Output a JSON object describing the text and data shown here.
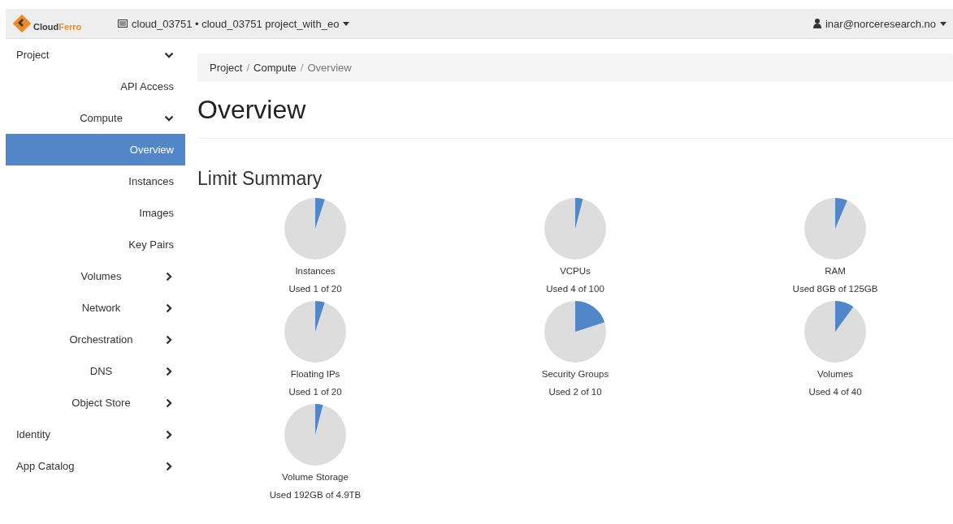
{
  "header": {
    "brand": "Cloud",
    "brand_accent": "Ferro",
    "project": "cloud_03751 • cloud_03751 project_with_eo",
    "user": "inar@norceresearch.no"
  },
  "sidebar": {
    "items": [
      {
        "label": "Project",
        "expanded": true,
        "selected": false,
        "children": [
          {
            "label": "API Access",
            "selected": false
          },
          {
            "label": "Compute",
            "expanded": true,
            "selected": false,
            "children": [
              {
                "label": "Overview",
                "selected": true
              },
              {
                "label": "Instances",
                "selected": false
              },
              {
                "label": "Images",
                "selected": false
              },
              {
                "label": "Key Pairs",
                "selected": false
              }
            ]
          },
          {
            "label": "Volumes",
            "expanded": false,
            "selected": false
          },
          {
            "label": "Network",
            "expanded": false,
            "selected": false
          },
          {
            "label": "Orchestration",
            "expanded": false,
            "selected": false
          },
          {
            "label": "DNS",
            "expanded": false,
            "selected": false
          },
          {
            "label": "Object Store",
            "expanded": false,
            "selected": false
          }
        ]
      },
      {
        "label": "Identity",
        "expanded": false,
        "selected": false
      },
      {
        "label": "App Catalog",
        "expanded": false,
        "selected": false
      }
    ]
  },
  "breadcrumb": [
    {
      "label": "Project",
      "separator": "/"
    },
    {
      "label": "Compute",
      "separator": "/"
    },
    {
      "label": "Overview"
    }
  ],
  "title": "Overview",
  "section_title": "Limit Summary",
  "limits": [
    {
      "name": "Instances",
      "usage": "Used 1 of 20"
    },
    {
      "name": "VCPUs",
      "usage": "Used 4 of 100"
    },
    {
      "name": "RAM",
      "usage": "Used 8GB of 125GB"
    },
    {
      "name": "Floating IPs",
      "usage": "Used 1 of 20"
    },
    {
      "name": "Security Groups",
      "usage": "Used 2 of 10"
    },
    {
      "name": "Volumes",
      "usage": "Used 4 of 40"
    },
    {
      "name": "Volume Storage",
      "usage": "Used 192GB of 4.9TB"
    }
  ]
}
